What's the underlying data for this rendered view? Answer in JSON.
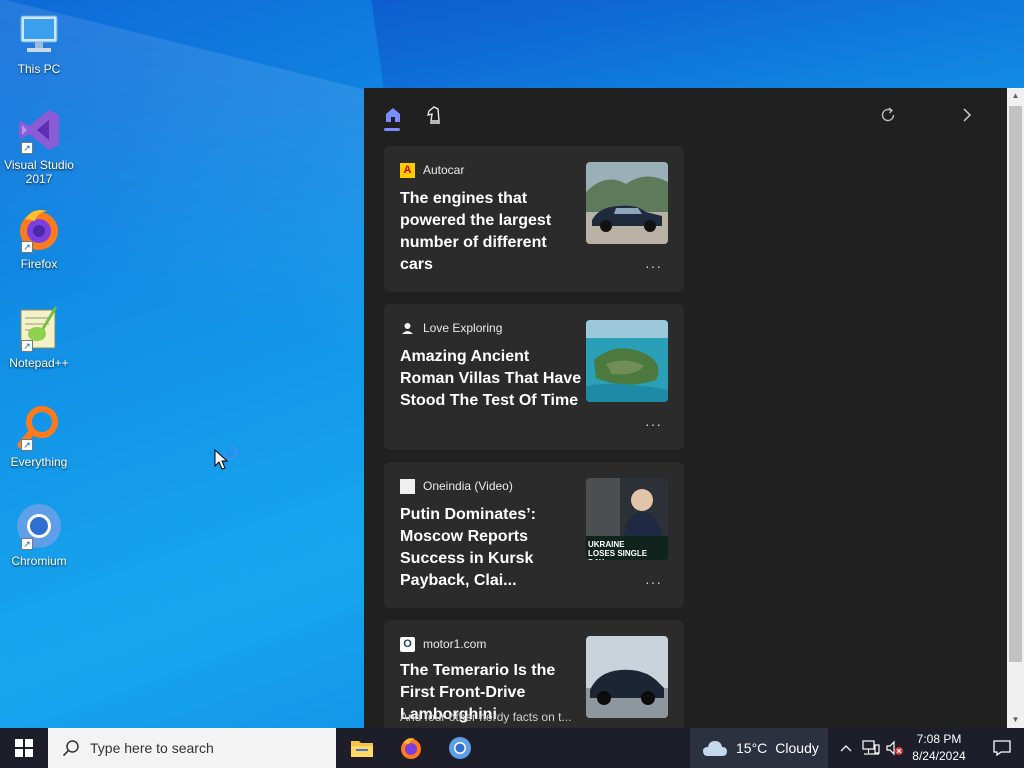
{
  "desktop": {
    "icons": [
      {
        "label": "This PC"
      },
      {
        "label": "Visual Studio 2017"
      },
      {
        "label": "Firefox"
      },
      {
        "label": "Notepad++"
      },
      {
        "label": "Everything"
      },
      {
        "label": "Chromium"
      }
    ]
  },
  "news_panel": {
    "cards": [
      {
        "source": "Autocar",
        "title": "The engines that powered the largest number of different cars",
        "more": "···"
      },
      {
        "source": "Love Exploring",
        "title": "Amazing Ancient Roman Villas That Have Stood The Test Of Time",
        "more": "···"
      },
      {
        "source": "Oneindia (Video)",
        "title": "Putin Dominates’: Moscow Reports Success in Kursk Payback, Clai...",
        "more": "···",
        "thumb_text": "UKRAINE LOSES SINGLE DAY"
      },
      {
        "source": "motor1.com",
        "title": "The Temerario Is the First Front-Drive Lamborghini",
        "subtitle": "And four other nerdy facts on t..."
      }
    ]
  },
  "taskbar": {
    "search_placeholder": "Type here to search",
    "weather": {
      "temp": "15°C",
      "condition": "Cloudy"
    },
    "clock": {
      "time": "7:08 PM",
      "date": "8/24/2024"
    }
  },
  "colors": {
    "accent": "#7a8cff",
    "panel_bg": "#202020",
    "card_bg": "#2b2b2b",
    "taskbar_bg": "#1e1e2a"
  }
}
